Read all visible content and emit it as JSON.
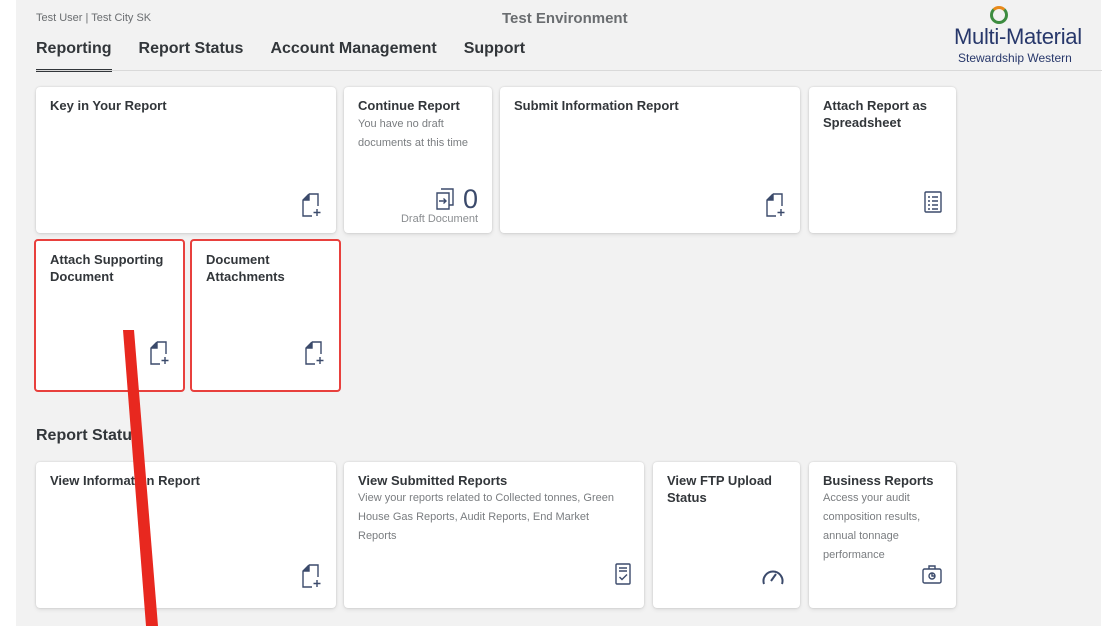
{
  "header": {
    "user_line": "Test User | Test City SK",
    "environment": "Test Environment",
    "logo": {
      "title": "Multi-Material",
      "subtitle": "Stewardship Western"
    }
  },
  "nav": {
    "tabs": [
      {
        "label": "Reporting",
        "active": true
      },
      {
        "label": "Report Status",
        "active": false
      },
      {
        "label": "Account Management",
        "active": false
      },
      {
        "label": "Support",
        "active": false
      }
    ]
  },
  "reporting": {
    "tiles": [
      {
        "title": "Key in Your Report",
        "icon": "add-document-icon"
      },
      {
        "title": "Continue Report",
        "subtitle": "You have no draft documents at this time",
        "kpi_value": "0",
        "kpi_label": "Draft Document",
        "icon": "open-document-icon"
      },
      {
        "title": "Submit Information Report",
        "icon": "add-document-icon"
      },
      {
        "title": "Attach Report as Spreadsheet",
        "icon": "spreadsheet-icon"
      },
      {
        "title": "Attach Supporting Document",
        "icon": "add-document-icon"
      },
      {
        "title": "Document Attachments",
        "icon": "add-document-icon"
      }
    ]
  },
  "report_status": {
    "title": "Report Status",
    "tiles": [
      {
        "title": "View Information Report",
        "icon": "add-document-icon"
      },
      {
        "title": "View Submitted Reports",
        "subtitle": "View your reports related to Collected tonnes, Green House Gas Reports, Audit Reports, End Market Reports",
        "icon": "checklist-document-icon"
      },
      {
        "title": "View FTP Upload Status",
        "icon": "gauge-icon"
      },
      {
        "title": "Business Reports",
        "subtitle": "Access your audit composition results, annual tonnage performance",
        "icon": "business-suitcase-icon"
      }
    ]
  },
  "colors": {
    "accent_icon": "#3b4a6b",
    "highlight": "#e8403d",
    "arrow": "#e8281f"
  }
}
